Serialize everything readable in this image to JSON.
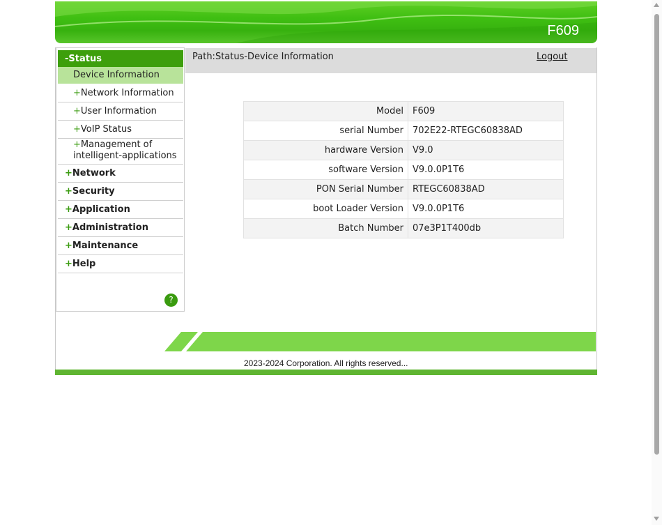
{
  "header": {
    "model": "F609"
  },
  "path": {
    "text": "Path:Status-Device Information",
    "logout": "Logout"
  },
  "menu": {
    "status": {
      "sign": "-",
      "label": "Status"
    },
    "status_items": [
      {
        "label": "Device Information"
      },
      {
        "sign": "+",
        "label": "Network Information"
      },
      {
        "sign": "+",
        "label": "User Information"
      },
      {
        "sign": "+",
        "label": "VoIP Status"
      },
      {
        "sign": "+",
        "label_line1": "Management of",
        "label_line2": "intelligent-applications"
      }
    ],
    "categories": [
      {
        "sign": "+",
        "label": "Network"
      },
      {
        "sign": "+",
        "label": "Security"
      },
      {
        "sign": "+",
        "label": "Application"
      },
      {
        "sign": "+",
        "label": "Administration"
      },
      {
        "sign": "+",
        "label": "Maintenance"
      },
      {
        "sign": "+",
        "label": "Help"
      }
    ],
    "help_icon": "?"
  },
  "device_info": [
    {
      "key": "Model",
      "value": "F609"
    },
    {
      "key": "serial Number",
      "value": "702E22-RTEGC60838AD"
    },
    {
      "key": "hardware Version",
      "value": "V9.0"
    },
    {
      "key": "software Version",
      "value": "V9.0.0P1T6"
    },
    {
      "key": "PON Serial Number",
      "value": "RTEGC60838AD"
    },
    {
      "key": "boot Loader Version",
      "value": "V9.0.0P1T6"
    },
    {
      "key": "Batch Number",
      "value": "07e3P1T400db"
    }
  ],
  "footer": {
    "copyright": "2023-2024 Corporation. All rights reserved..."
  },
  "colors": {
    "brand_green": "#3d9f0c",
    "selected_bg": "#b8e39a",
    "footer_green": "#7ed64a"
  }
}
